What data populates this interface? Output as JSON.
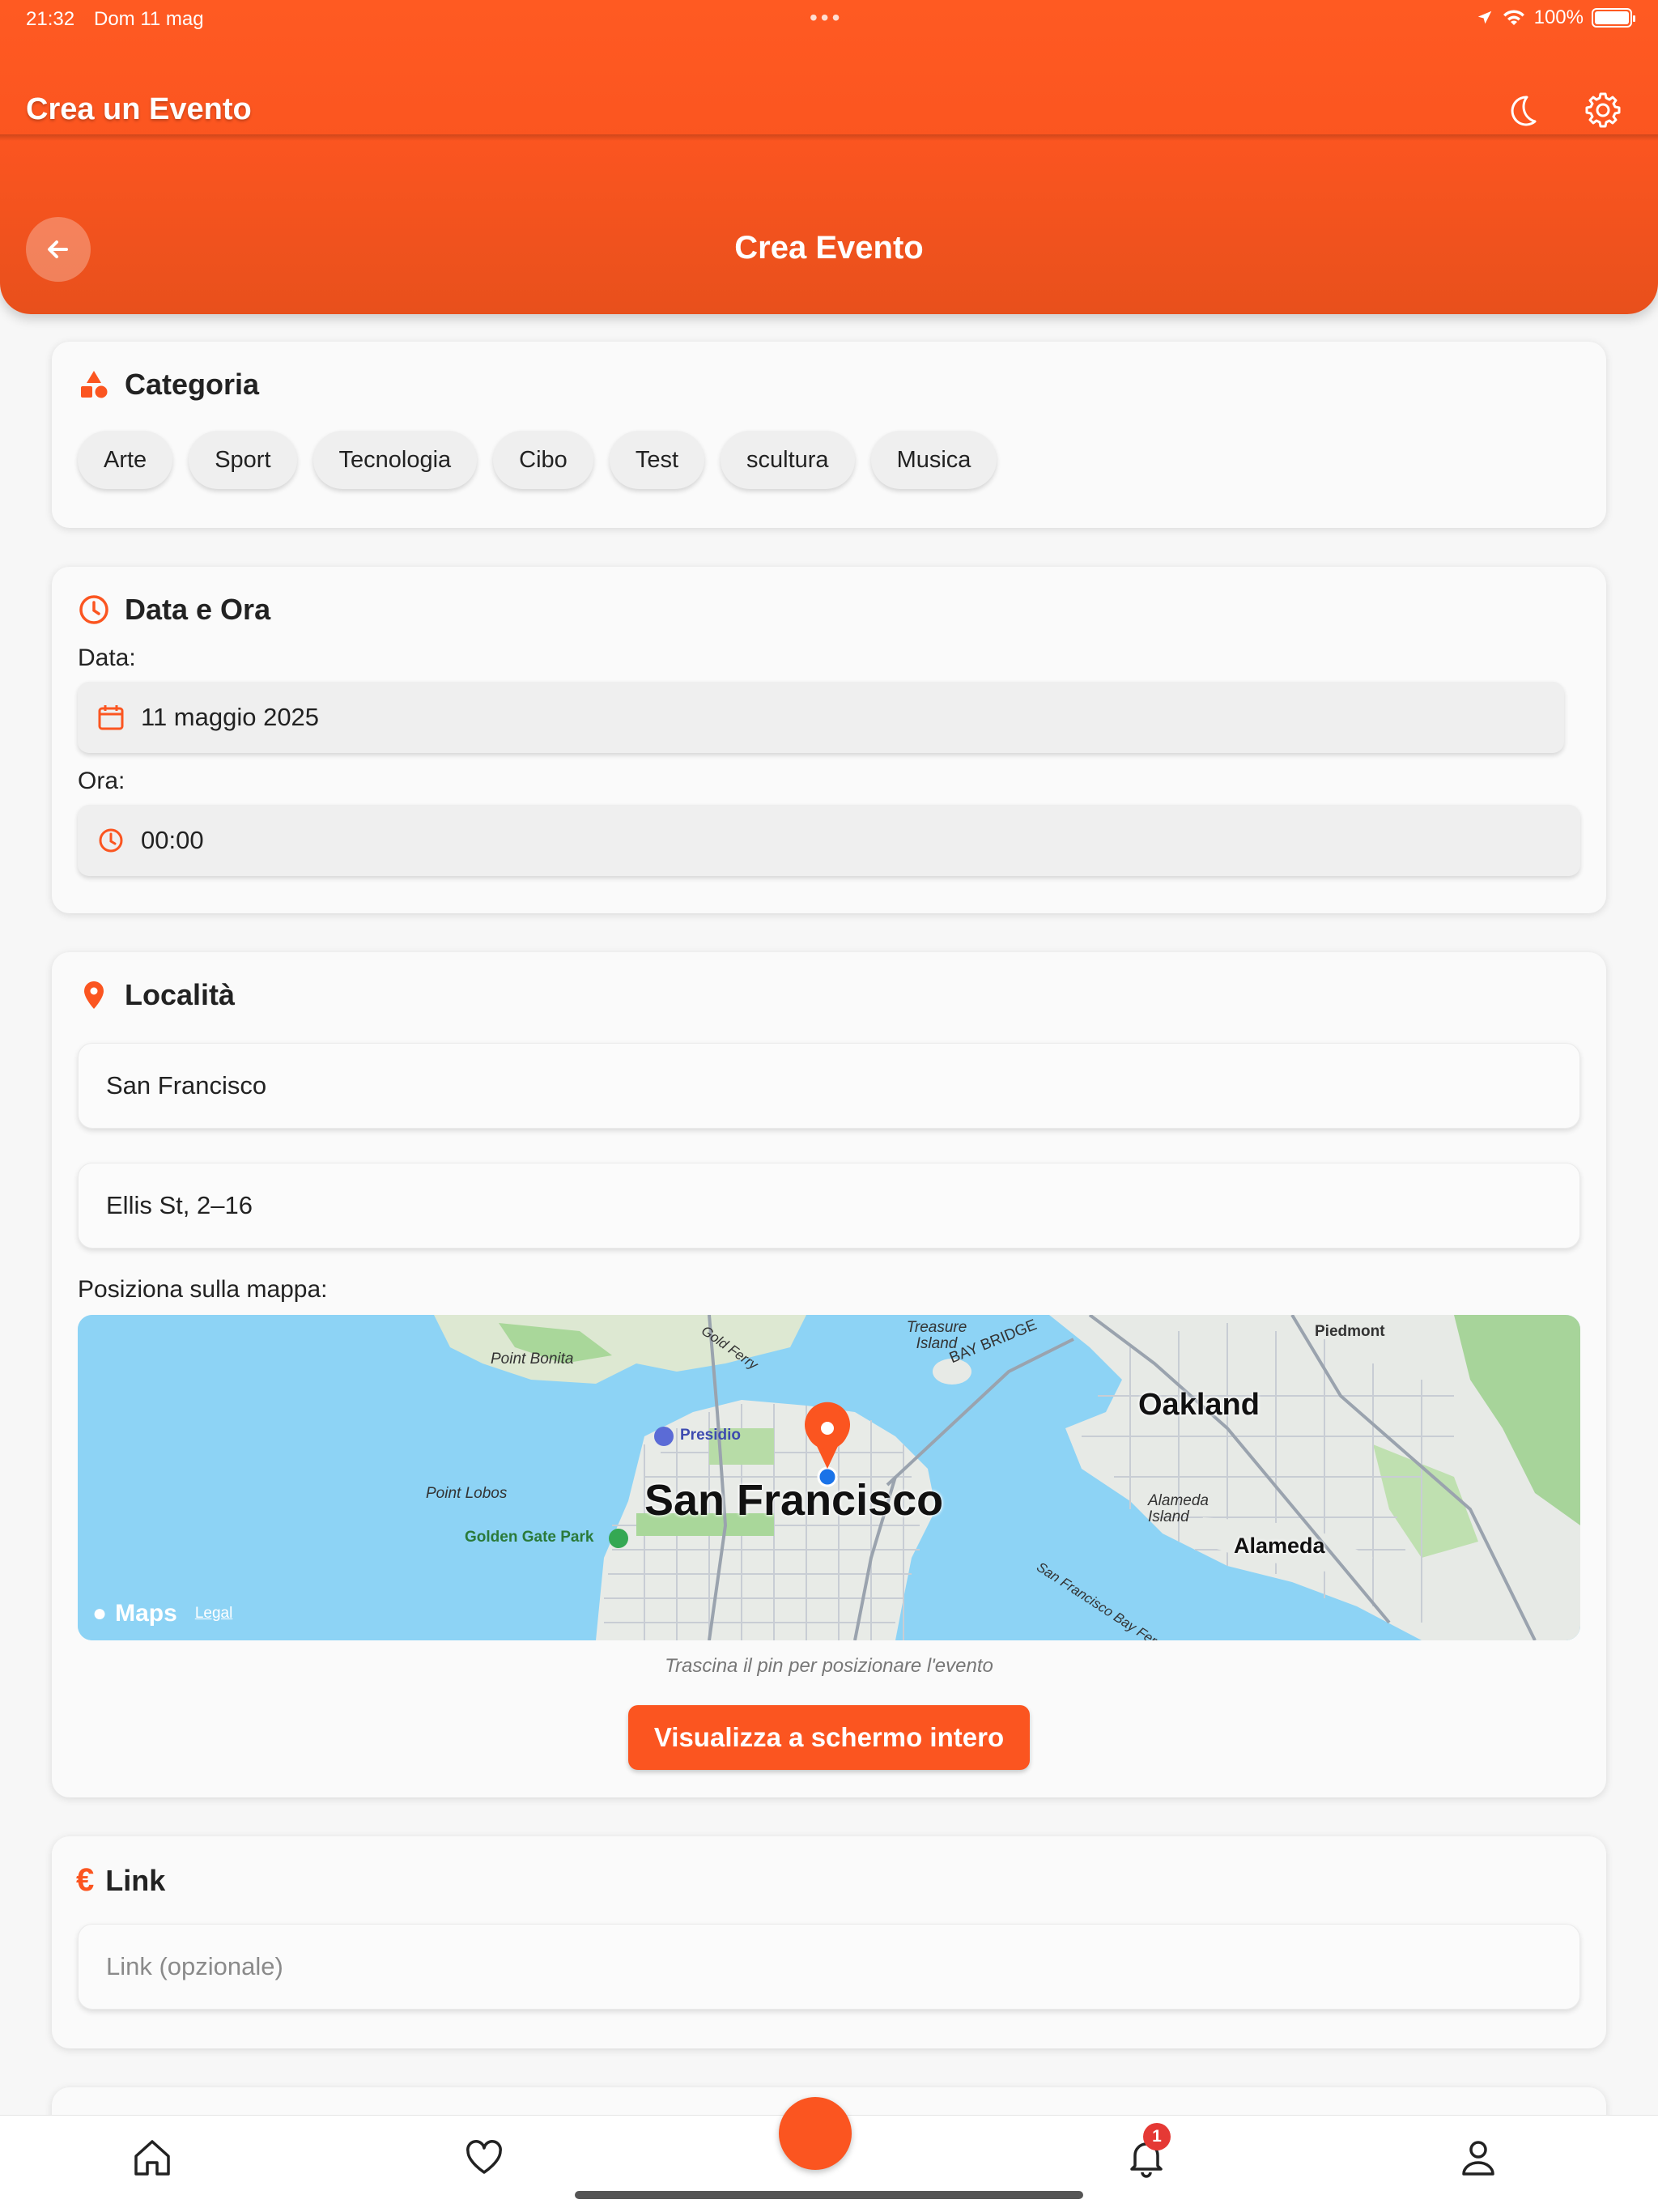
{
  "status_bar": {
    "time": "21:32",
    "date": "Dom 11 mag",
    "battery": "100%",
    "battery_level": 1.0
  },
  "app_bar": {
    "title": "Crea un Evento",
    "icons": [
      "moon-icon",
      "gear-icon"
    ]
  },
  "page": {
    "title": "Crea Evento"
  },
  "category": {
    "title": "Categoria",
    "chips": [
      "Arte",
      "Sport",
      "Tecnologia",
      "Cibo",
      "Test",
      "scultura",
      "Musica"
    ]
  },
  "datetime": {
    "title": "Data e Ora",
    "date_label": "Data:",
    "date_value": "11 maggio 2025",
    "time_label": "Ora:",
    "time_value": "00:00"
  },
  "location": {
    "title": "Località",
    "city_value": "San Francisco",
    "address_value": "Ellis St, 2–16",
    "map_label": "Posiziona sulla mappa:",
    "map_places": {
      "city": "San Francisco",
      "oakland": "Oakland",
      "alameda": "Alameda",
      "alameda_island": "Alameda Island",
      "piedmont": "Piedmont",
      "presidio": "Presidio",
      "golden_gate_park": "Golden Gate Park",
      "point_bonita": "Point Bonita",
      "point_lobos": "Point Lobos",
      "treasure_island": "Treasure Island",
      "bay_bridge": "BAY BRIDGE",
      "ferry": "San Francisco Bay Ferry",
      "gold_ferry": "Gold Ferry"
    },
    "map_brand": "Maps",
    "map_legal": "Legal",
    "map_hint": "Trascina il pin per posizionare l'evento",
    "fullscreen_button": "Visualizza a schermo intero"
  },
  "link": {
    "title": "Link",
    "placeholder": "Link (opzionale)"
  },
  "tab_bar": {
    "notification_count": "1",
    "tabs": [
      "home-icon",
      "heart-icon",
      "create-fab",
      "bell-icon",
      "user-icon"
    ]
  },
  "colors": {
    "accent": "#fb5520",
    "badge": "#e53935"
  }
}
